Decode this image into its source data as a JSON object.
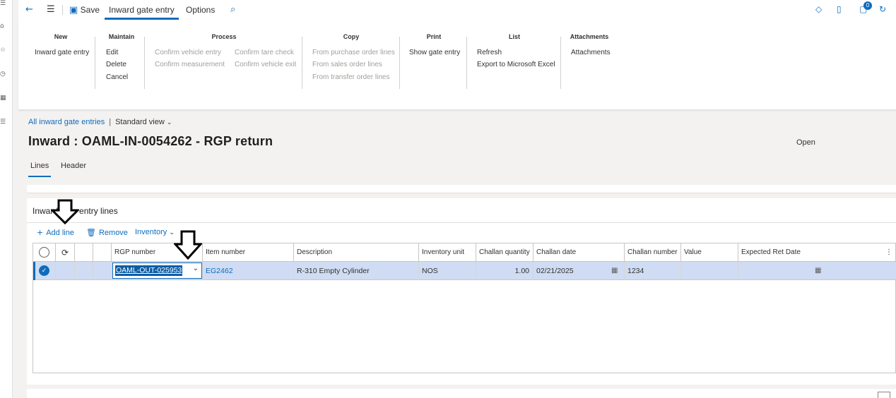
{
  "topbar": {
    "back_icon": "arrow-left-icon",
    "menu_icon": "hamburger-icon",
    "save_label": "Save",
    "tabs": [
      {
        "label": "Inward gate entry",
        "active": true
      },
      {
        "label": "Options",
        "active": false
      }
    ],
    "search_icon": "search-icon",
    "notifications_count": "0"
  },
  "ribbon": {
    "groups": [
      {
        "title": "New",
        "buttons": [
          {
            "label": "Inward gate entry",
            "enabled": true
          }
        ]
      },
      {
        "title": "Maintain",
        "buttons": [
          {
            "label": "Edit",
            "enabled": true
          },
          {
            "label": "Delete",
            "enabled": true
          },
          {
            "label": "Cancel",
            "enabled": true
          }
        ]
      },
      {
        "title": "Process",
        "buttons": [
          {
            "label": "Confirm vehicle entry",
            "enabled": false
          },
          {
            "label": "Confirm measurement",
            "enabled": false
          },
          {
            "label": "Confirm tare check",
            "enabled": false
          },
          {
            "label": "Confirm vehicle exit",
            "enabled": false
          }
        ]
      },
      {
        "title": "Copy",
        "buttons": [
          {
            "label": "From purchase order lines",
            "enabled": false
          },
          {
            "label": "From sales order lines",
            "enabled": false
          },
          {
            "label": "From transfer order lines",
            "enabled": false
          }
        ]
      },
      {
        "title": "Print",
        "buttons": [
          {
            "label": "Show gate entry",
            "enabled": true
          }
        ]
      },
      {
        "title": "List",
        "buttons": [
          {
            "label": "Refresh",
            "enabled": true
          },
          {
            "label": "Export to Microsoft Excel",
            "enabled": true
          }
        ]
      },
      {
        "title": "Attachments",
        "buttons": [
          {
            "label": "Attachments",
            "enabled": true
          }
        ]
      }
    ]
  },
  "breadcrumb": {
    "link": "All inward gate entries",
    "separator": "|",
    "view": "Standard view"
  },
  "page": {
    "title": "Inward : OAML-IN-0054262 - RGP return",
    "status": "Open",
    "tabs": [
      {
        "label": "Lines",
        "active": true
      },
      {
        "label": "Header",
        "active": false
      }
    ]
  },
  "lines_panel": {
    "title": "Inward gate entry lines",
    "toolbar": {
      "add_line": "Add line",
      "remove": "Remove",
      "inventory": "Inventory"
    },
    "columns": [
      "RGP number",
      "Item number",
      "Description",
      "Inventory unit",
      "Challan quantity",
      "Challan date",
      "Challan number",
      "Value",
      "Expected Ret Date"
    ],
    "rows": [
      {
        "selected": true,
        "rgp_number": "OAML-OUT-025953",
        "item_number": "EG2462",
        "description": "R-310 Empty Cylinder",
        "inventory_unit": "NOS",
        "challan_quantity": "1.00",
        "challan_date": "02/21/2025",
        "challan_number": "1234",
        "value": "",
        "expected_ret_date": ""
      }
    ]
  },
  "colors": {
    "accent": "#0f6cbd",
    "selected_row": "#cfdcf3",
    "disabled_text": "#a19f9d"
  }
}
